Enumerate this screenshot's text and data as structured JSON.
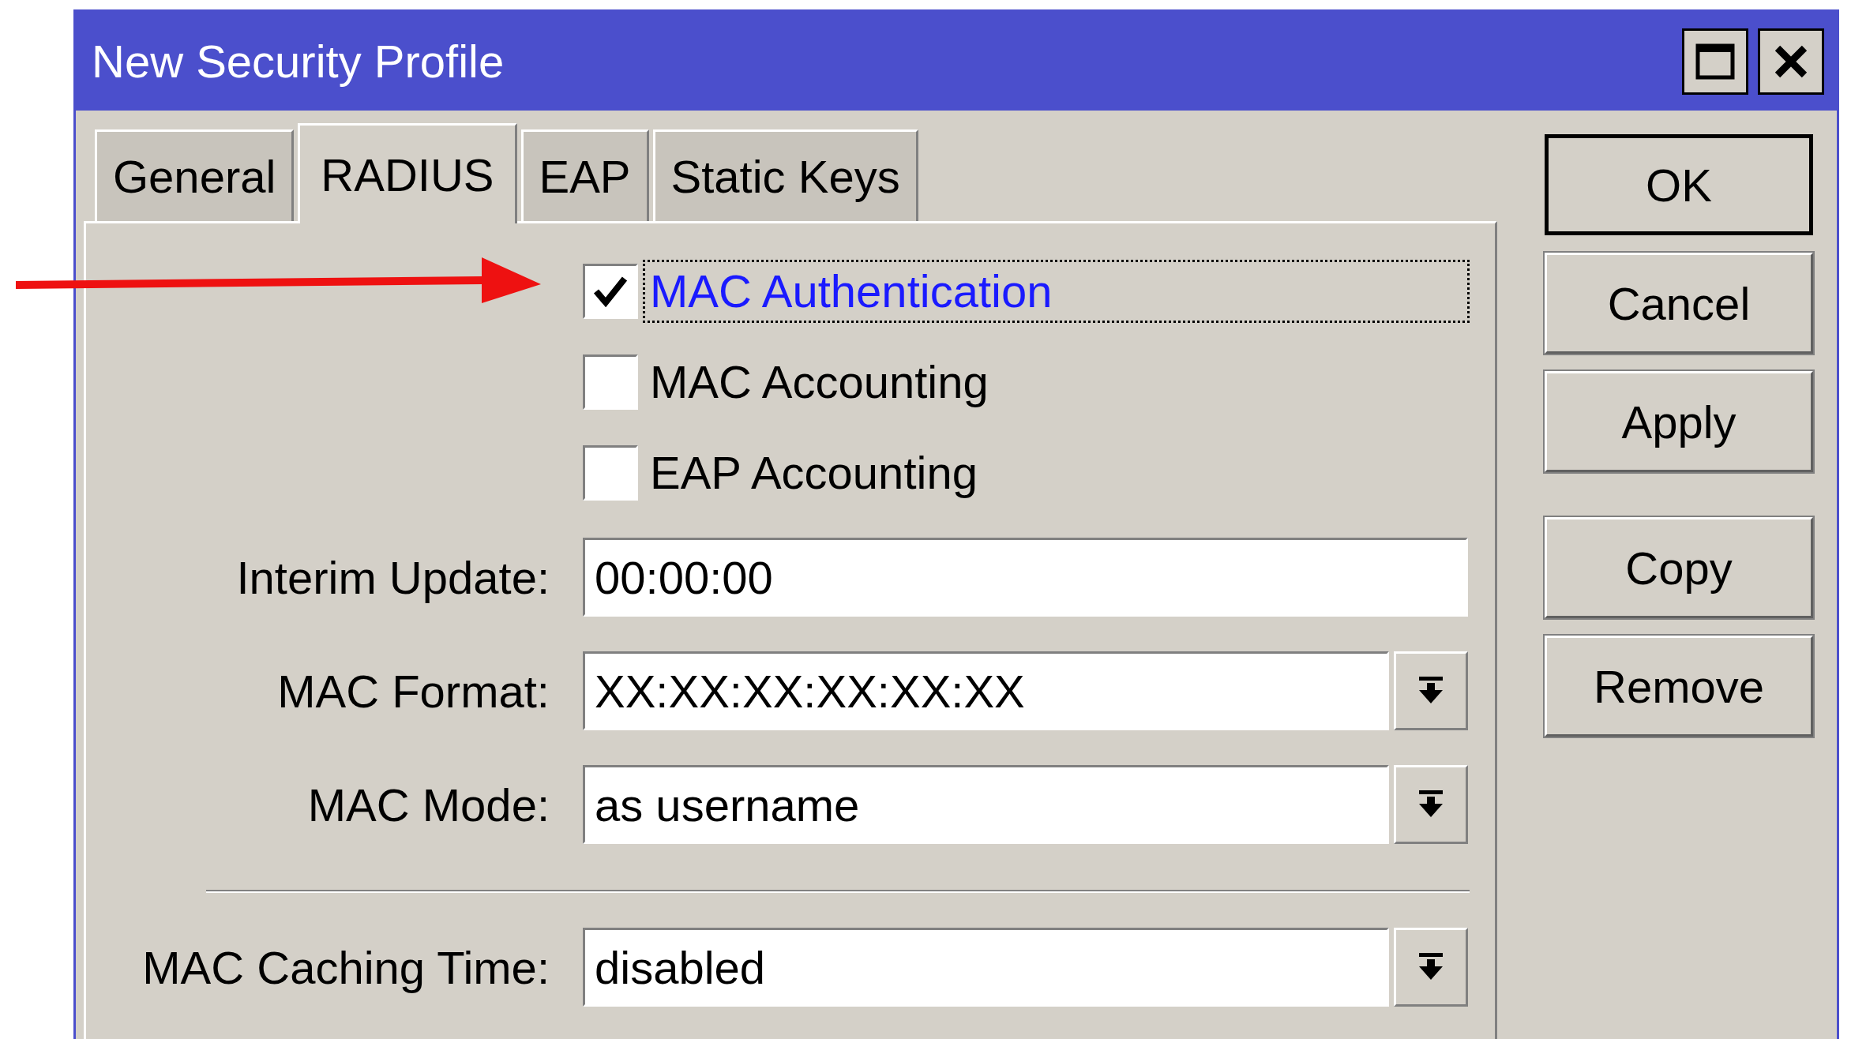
{
  "window": {
    "title": "New Security Profile"
  },
  "tabs": [
    {
      "label": "General",
      "selected": false
    },
    {
      "label": "RADIUS",
      "selected": true
    },
    {
      "label": "EAP",
      "selected": false
    },
    {
      "label": "Static Keys",
      "selected": false
    }
  ],
  "checkboxes": [
    {
      "label": "MAC Authentication",
      "checked": true,
      "focused": true
    },
    {
      "label": "MAC Accounting",
      "checked": false,
      "focused": false
    },
    {
      "label": "EAP Accounting",
      "checked": false,
      "focused": false
    }
  ],
  "fields": [
    {
      "label": "Interim Update:",
      "value": "00:00:00",
      "kind": "text"
    },
    {
      "label": "MAC Format:",
      "value": "XX:XX:XX:XX:XX:XX",
      "kind": "dropdown"
    },
    {
      "label": "MAC Mode:",
      "value": "as username",
      "kind": "dropdown"
    }
  ],
  "fields_after_separator": [
    {
      "label": "MAC Caching Time:",
      "value": "disabled",
      "kind": "dropdown"
    }
  ],
  "button_groups": [
    [
      {
        "label": "OK",
        "default": true
      },
      {
        "label": "Cancel",
        "default": false
      },
      {
        "label": "Apply",
        "default": false
      }
    ],
    [
      {
        "label": "Copy",
        "default": false
      },
      {
        "label": "Remove",
        "default": false
      }
    ]
  ]
}
